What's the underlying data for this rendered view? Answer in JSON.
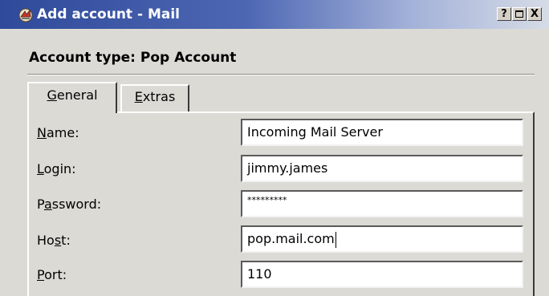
{
  "window": {
    "title": "Add account - Mail",
    "icon": "mail-app-icon",
    "buttons": {
      "help": "?",
      "maximize": "",
      "close": "X"
    }
  },
  "heading": {
    "account_type": "Account type: Pop Account"
  },
  "tabs": [
    {
      "label_prefix": "",
      "mnemonic": "G",
      "label_rest": "eneral",
      "active": true
    },
    {
      "label_prefix": "",
      "mnemonic": "E",
      "label_rest": "xtras",
      "active": false
    }
  ],
  "fields": {
    "name": {
      "label_prefix": "",
      "mnemonic": "N",
      "label_rest": "ame:",
      "value": "Incoming Mail Server"
    },
    "login": {
      "label_prefix": "",
      "mnemonic": "L",
      "label_rest": "ogin:",
      "value": "jimmy.james"
    },
    "password": {
      "label_prefix": "P",
      "mnemonic": "a",
      "label_rest": "ssword:",
      "value": "*********"
    },
    "host": {
      "label_prefix": "Ho",
      "mnemonic": "s",
      "label_rest": "t:",
      "value": "pop.mail.com"
    },
    "port": {
      "label_prefix": "",
      "mnemonic": "P",
      "label_rest": "ort:",
      "value": "110"
    }
  },
  "colors": {
    "titlebar_start": "#2f4a9a",
    "titlebar_end": "#d6dbe6",
    "dialog_bg": "#dcdad5"
  }
}
